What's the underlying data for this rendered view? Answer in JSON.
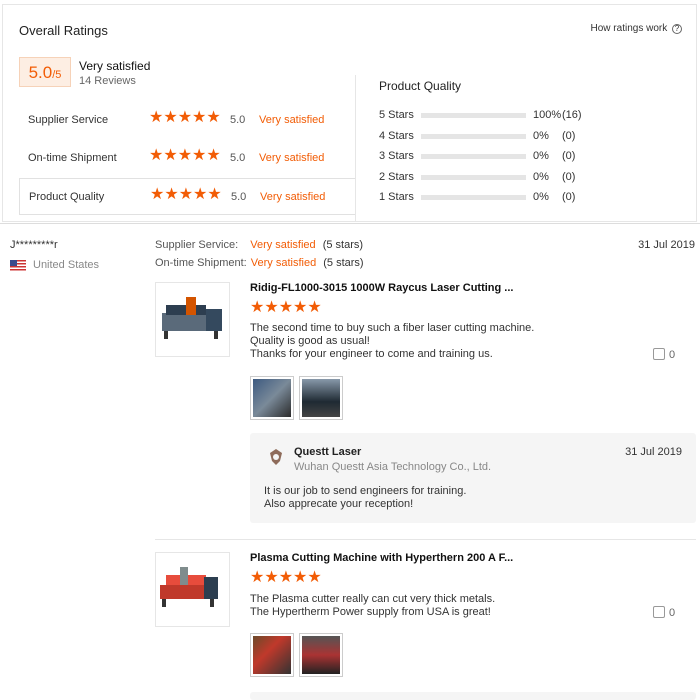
{
  "header": {
    "title": "Overall Ratings",
    "how_link": "How ratings work",
    "help_icon": "?"
  },
  "summary": {
    "score": "5.0",
    "score_max": "/5",
    "label": "Very satisfied",
    "reviews": "14 Reviews"
  },
  "dimensions": [
    {
      "label": "Supplier Service",
      "stars": 5,
      "score": "5.0",
      "text": "Very satisfied"
    },
    {
      "label": "On-time Shipment",
      "stars": 5,
      "score": "5.0",
      "text": "Very satisfied"
    },
    {
      "label": "Product Quality",
      "stars": 5,
      "score": "5.0",
      "text": "Very satisfied"
    }
  ],
  "product_quality": {
    "title": "Product Quality",
    "rows": [
      {
        "label": "5 Stars",
        "fraction": 1.0,
        "pct": "100%",
        "count": "(16)"
      },
      {
        "label": "4 Stars",
        "fraction": 0,
        "pct": "0%",
        "count": "(0)"
      },
      {
        "label": "3 Stars",
        "fraction": 0,
        "pct": "0%",
        "count": "(0)"
      },
      {
        "label": "2 Stars",
        "fraction": 0,
        "pct": "0%",
        "count": "(0)"
      },
      {
        "label": "1 Stars",
        "fraction": 0,
        "pct": "0%",
        "count": "(0)"
      }
    ]
  },
  "review": {
    "buyer": "J*********r",
    "country": "United States",
    "supplier_service_label": "Supplier Service:",
    "supplier_service_value": "Very satisfied",
    "supplier_service_stars": "(5 stars)",
    "shipment_label": "On-time Shipment:",
    "shipment_value": "Very satisfied",
    "shipment_stars": "(5 stars)",
    "date": "31 Jul 2019",
    "items": [
      {
        "product": "Ridig-FL1000-3015 1000W Raycus Laser Cutting ...",
        "stars": 5,
        "comment": [
          "The second time to buy such a fiber laser cutting machine.",
          "Quality is good as usual!",
          "Thanks for your engineer to come and training us."
        ],
        "likes": "0"
      },
      {
        "product": "Plasma Cutting Machine with Hyperthern 200 A F...",
        "stars": 5,
        "comment": [
          "The Plasma cutter really can cut very thick metals.",
          "The Hypertherm Power supply from USA is great!"
        ],
        "likes": "0"
      }
    ],
    "reply": {
      "name": "Questt Laser",
      "company": "Wuhan Questt Asia Technology Co., Ltd.",
      "date": "31 Jul 2019",
      "text": [
        "It is our job to send engineers for training.",
        "Also apprecate your  reception!"
      ]
    }
  },
  "colors": {
    "accent": "#f25c05"
  }
}
